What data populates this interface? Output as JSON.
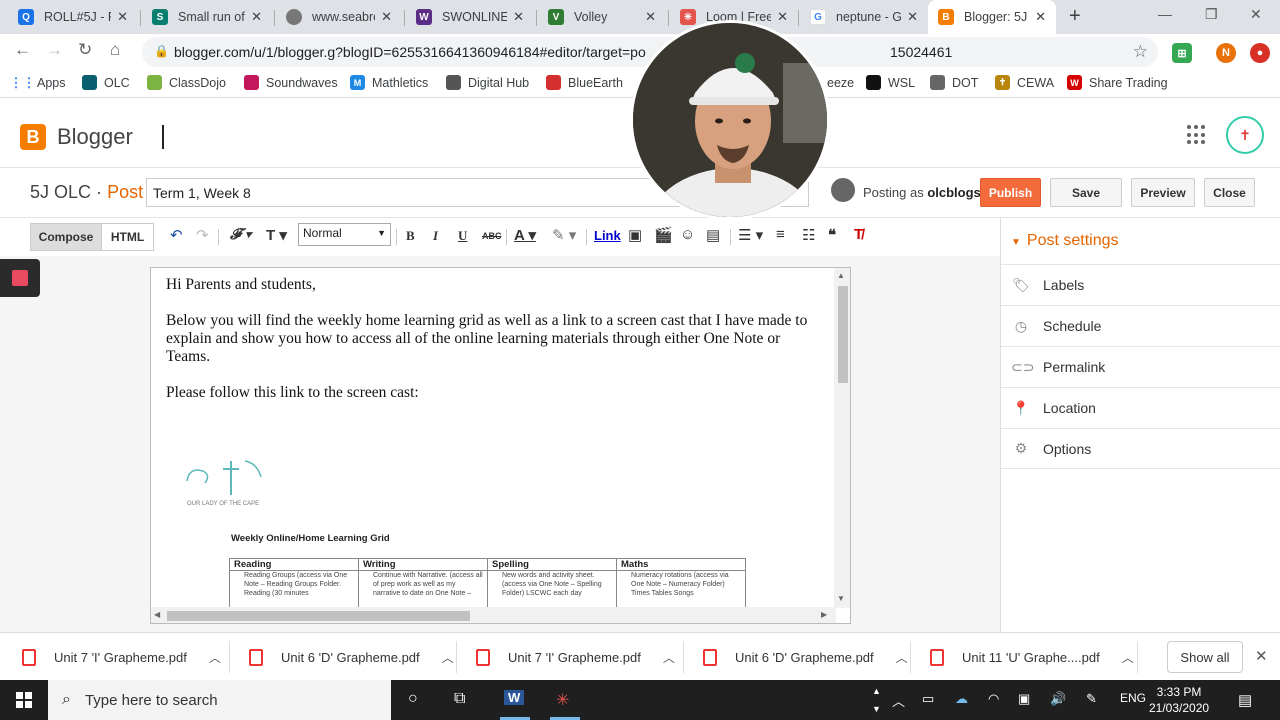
{
  "browser": {
    "tabs": [
      {
        "title": "ROLL#5J - R",
        "fav": "#1a73e8",
        "glyph": "Q"
      },
      {
        "title": "Small run of",
        "fav": "#0a7f6f",
        "glyph": "S"
      },
      {
        "title": "www.seabre",
        "fav": "#777",
        "glyph": "●"
      },
      {
        "title": "SWONLINE_",
        "fav": "#5b2d86",
        "glyph": "W"
      },
      {
        "title": "Volley",
        "fav": "#2e7d32",
        "glyph": "V"
      },
      {
        "title": "Loom | Free",
        "fav": "#e2544d",
        "glyph": "✳"
      },
      {
        "title": "neptune - G",
        "fav": "#4285f4",
        "glyph": "G"
      },
      {
        "title": "Blogger: 5J C",
        "fav": "#f57d00",
        "glyph": "B"
      }
    ],
    "url": "blogger.com/u/1/blogger.g?blogID=6255316641360946184#editor/target=po",
    "url_tail": "15024461",
    "profile_letter": "N"
  },
  "bookmarks": [
    {
      "label": "Apps",
      "color": "#4285f4"
    },
    {
      "label": "OLC",
      "color": "#0a5f6f"
    },
    {
      "label": "ClassDojo",
      "color": "#7cb342"
    },
    {
      "label": "Soundwaves",
      "color": "#c2185b"
    },
    {
      "label": "Mathletics",
      "color": "#1e88e5"
    },
    {
      "label": "Digital Hub",
      "color": "#555"
    },
    {
      "label": "BlueEarth",
      "color": "#d32f2f"
    },
    {
      "label": "eeze",
      "color": "#888"
    },
    {
      "label": "WSL",
      "color": "#111"
    },
    {
      "label": "DOT",
      "color": "#666"
    },
    {
      "label": "CEWA",
      "color": "#b8860b"
    },
    {
      "label": "Share Trading",
      "color": "#d50000"
    }
  ],
  "blogger": {
    "brand": "Blogger",
    "blog_name": "5J OLC",
    "separator": "·",
    "post_label": "Post",
    "post_title": "Term 1, Week 8",
    "posting_as_prefix": "Posting as",
    "posting_as_user": "olcblogs",
    "buttons": {
      "publish": "Publish",
      "save": "Save",
      "preview": "Preview",
      "close": "Close"
    }
  },
  "toolbar": {
    "compose": "Compose",
    "html": "HTML",
    "format": "Normal",
    "link": "Link"
  },
  "editor": {
    "paragraphs": [
      "Hi Parents and students,",
      "Below you will find the weekly home learning grid as well as a link to a screen cast that I have made to explain and show you how to access all of the online learning materials through either One Note or Teams.",
      "Please follow this link to the screen cast:"
    ],
    "grid_title": "Weekly Online/Home Learning Grid",
    "school_logo_text": "OUR LADY OF THE CAPE",
    "grid_headers": [
      "Reading",
      "Writing",
      "Spelling",
      "Maths"
    ],
    "grid_cells": [
      "Reading Groups (access via One Note – Reading Groups Folder. Reading (30 minutes",
      "Continue with Narrative. (access all of prep work as well as my narrative to date on One Note –",
      "New words and activity sheet. (access via One Note – Spelling Folder) LSCWC each day",
      "Numeracy rotations (access via One Note – Numeracy Folder) Times Tables Songs"
    ]
  },
  "sidebar": {
    "heading": "Post settings",
    "items": [
      {
        "label": "Labels",
        "icon": "tag-icon"
      },
      {
        "label": "Schedule",
        "icon": "clock-icon"
      },
      {
        "label": "Permalink",
        "icon": "link-icon"
      },
      {
        "label": "Location",
        "icon": "pin-icon"
      },
      {
        "label": "Options",
        "icon": "gear-icon"
      }
    ]
  },
  "downloads": {
    "items": [
      "Unit 7 'I' Grapheme.pdf",
      "Unit 6 'D' Grapheme.pdf",
      "Unit 7 'I' Grapheme.pdf",
      "Unit 6 'D' Grapheme.pdf",
      "Unit 11 'U' Graphe....pdf"
    ],
    "show_all": "Show all"
  },
  "taskbar": {
    "search_placeholder": "Type here to search",
    "language": "ENG",
    "time": "3:33 PM",
    "date": "21/03/2020"
  }
}
